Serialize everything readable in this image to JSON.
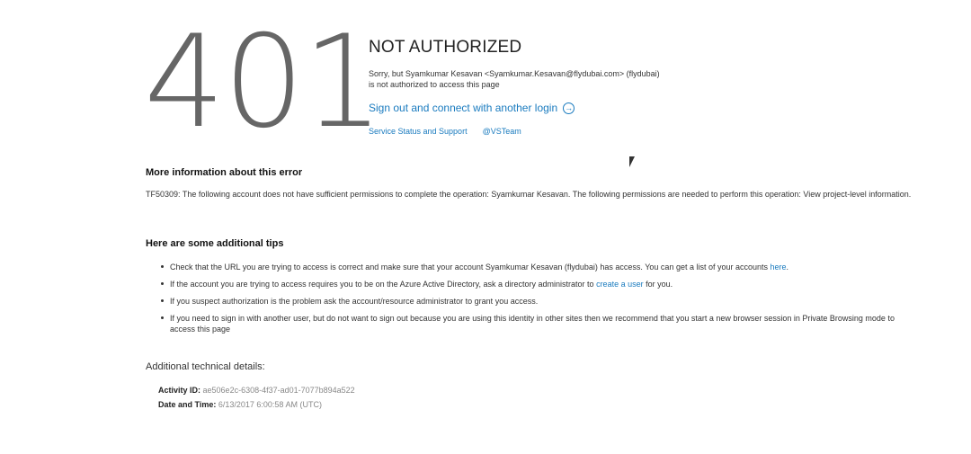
{
  "error": {
    "code": "401",
    "title": "NOT AUTHORIZED",
    "message_line1": "Sorry, but Syamkumar Kesavan <Syamkumar.Kesavan@flydubai.com> (flydubai)",
    "message_line2": "is not authorized to access this page",
    "signout_label": "Sign out and connect with another login",
    "signout_icon": "arrow-circle-right-icon",
    "link_status": "Service Status and Support",
    "link_vsteam": "@VSTeam"
  },
  "more_info": {
    "heading": "More information about this error",
    "text": "TF50309: The following account does not have sufficient permissions to complete the operation: Syamkumar Kesavan. The following permissions are needed to perform this operation: View project-level information."
  },
  "tips": {
    "heading": "Here are some additional tips",
    "items": [
      {
        "before": "Check that the URL you are trying to access is correct and make sure that your account Syamkumar Kesavan (flydubai) has access. You can get a list of your accounts ",
        "link": "here",
        "after": "."
      },
      {
        "before": "If the account you are trying to access requires you to be on the Azure Active Directory, ask a directory administrator to ",
        "link": "create a user",
        "after": " for you."
      },
      {
        "text": "If you suspect authorization is the problem ask the account/resource administrator to grant you access."
      },
      {
        "text": "If you need to sign in with another user, but do not want to sign out because you are using this identity in other sites then we recommend that you start a new browser session in Private Browsing mode to access this page"
      }
    ]
  },
  "technical": {
    "heading": "Additional technical details:",
    "activity_label": "Activity ID:",
    "activity_value": "ae506e2c-6308-4f37-ad01-7077b894a522",
    "date_label": "Date and Time:",
    "date_value": "6/13/2017 6:00:58 AM (UTC)"
  },
  "colors": {
    "link": "#1a7bbf",
    "code": "#666666"
  }
}
